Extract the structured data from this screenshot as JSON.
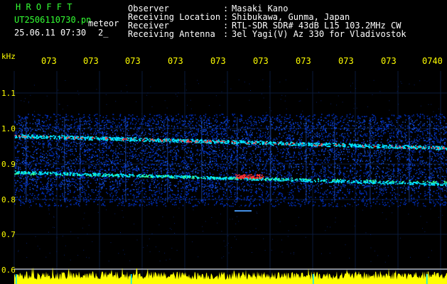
{
  "header": {
    "brand": "H R O F F T",
    "filename": "UT2506110730.pn",
    "mode": "meteor",
    "datetime": "25.06.11 07:30",
    "counter": "2_",
    "info_labels": [
      "Observer",
      "Receiving Location",
      "Receiver",
      "Receiving Antenna"
    ],
    "info_sep": ":",
    "info_values": [
      "Masaki Kano",
      "Shibukawa, Gunma, Japan",
      "RTL-SDR SDR# 43dB L15 103.2MHz CW",
      "3el Yagi(V) Az 330 for Vladivostok"
    ]
  },
  "axis": {
    "unit": "kHz",
    "y_labels": [
      "1.1",
      "1.0",
      "0.9",
      "0.8",
      "0.7",
      "0.6"
    ],
    "x_labels": [
      "073",
      "073",
      "073",
      "073",
      "073",
      "073",
      "073",
      "073",
      "073",
      "0740"
    ]
  },
  "colors": {
    "background": "#000000",
    "axis_text": "#ffff00",
    "header_green": "#33ff33",
    "header_white": "#ffffff",
    "noise_floor": "#ffff00",
    "signal_low": "#0033cc",
    "signal_mid": "#00e5ff",
    "signal_high": "#ff3030"
  }
}
